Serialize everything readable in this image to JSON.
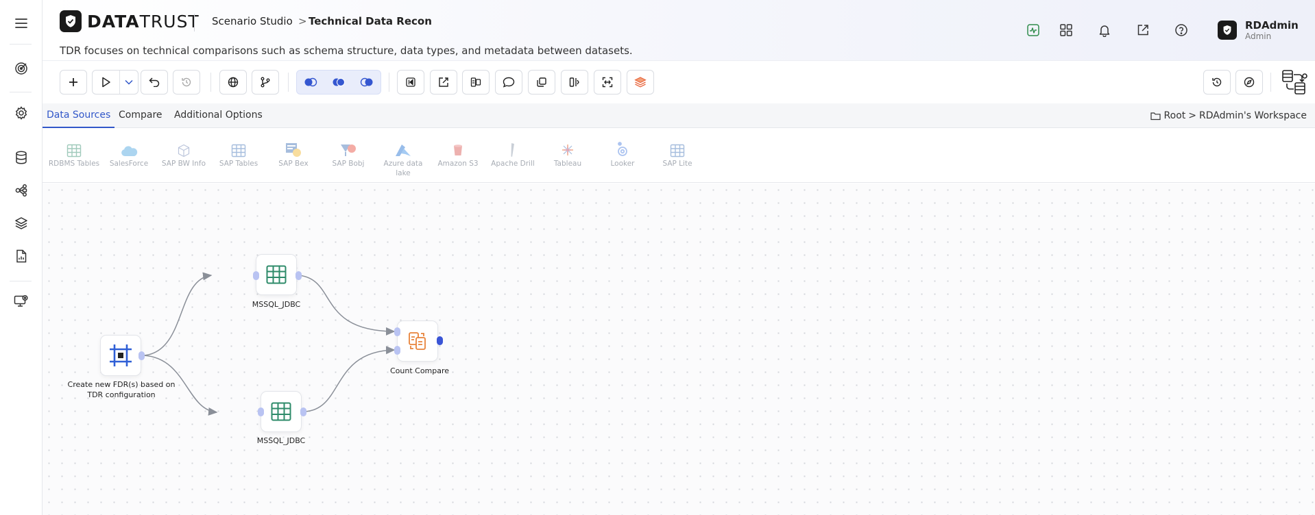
{
  "app": {
    "logo_bold": "DATA",
    "logo_light": "TRUST",
    "breadcrumb_parent": "Scenario Studio",
    "breadcrumb_sep": ">",
    "breadcrumb_current": "Technical Data Recon",
    "description": "TDR focuses on technical comparisons such as schema structure, data types, and metadata between datasets."
  },
  "user": {
    "name": "RDAdmin",
    "role": "Admin"
  },
  "header_icons": [
    "activity-icon",
    "apps-grid-icon",
    "bell-icon",
    "external-link-icon",
    "help-icon"
  ],
  "rail_icons": [
    "menu-icon",
    "target-icon",
    "settings-icon",
    "database-icon",
    "graph-nodes-icon",
    "layers-icon",
    "report-file-icon",
    "monitor-cog-icon"
  ],
  "tabs": [
    {
      "label": "Data Sources",
      "active": true
    },
    {
      "label": "Compare",
      "active": false
    },
    {
      "label": "Additional Options",
      "active": false
    }
  ],
  "workspace": {
    "root": "Root",
    "sep": ">",
    "name": "RDAdmin's Workspace"
  },
  "palette": [
    {
      "label": "RDBMS Tables",
      "icon": "table-icon"
    },
    {
      "label": "SalesForce",
      "icon": "cloud-icon"
    },
    {
      "label": "SAP BW Info",
      "icon": "cube-icon"
    },
    {
      "label": "SAP Tables",
      "icon": "table-icon"
    },
    {
      "label": "SAP Bex",
      "icon": "bex-icon"
    },
    {
      "label": "SAP Bobj",
      "icon": "bobj-icon"
    },
    {
      "label": "Azure data lake",
      "icon": "azure-icon"
    },
    {
      "label": "Amazon S3",
      "icon": "s3-icon"
    },
    {
      "label": "Apache Drill",
      "icon": "drill-icon"
    },
    {
      "label": "Tableau",
      "icon": "tableau-icon"
    },
    {
      "label": "Looker",
      "icon": "looker-icon"
    },
    {
      "label": "SAP Lite",
      "icon": "table-icon"
    }
  ],
  "nodes": {
    "source": {
      "label": "Create new FDR(s) based on TDR configuration"
    },
    "top": {
      "label": "MSSQL_JDBC"
    },
    "bottom": {
      "label": "MSSQL_JDBC"
    },
    "compare": {
      "label": "Count Compare"
    }
  },
  "colors": {
    "accent": "#3157c9",
    "table_green": "#2e8b6a",
    "compare_orange": "#e8833a",
    "port": "#b9c3f2",
    "port_strong": "#3a55d6",
    "edge": "#8a8f98"
  }
}
